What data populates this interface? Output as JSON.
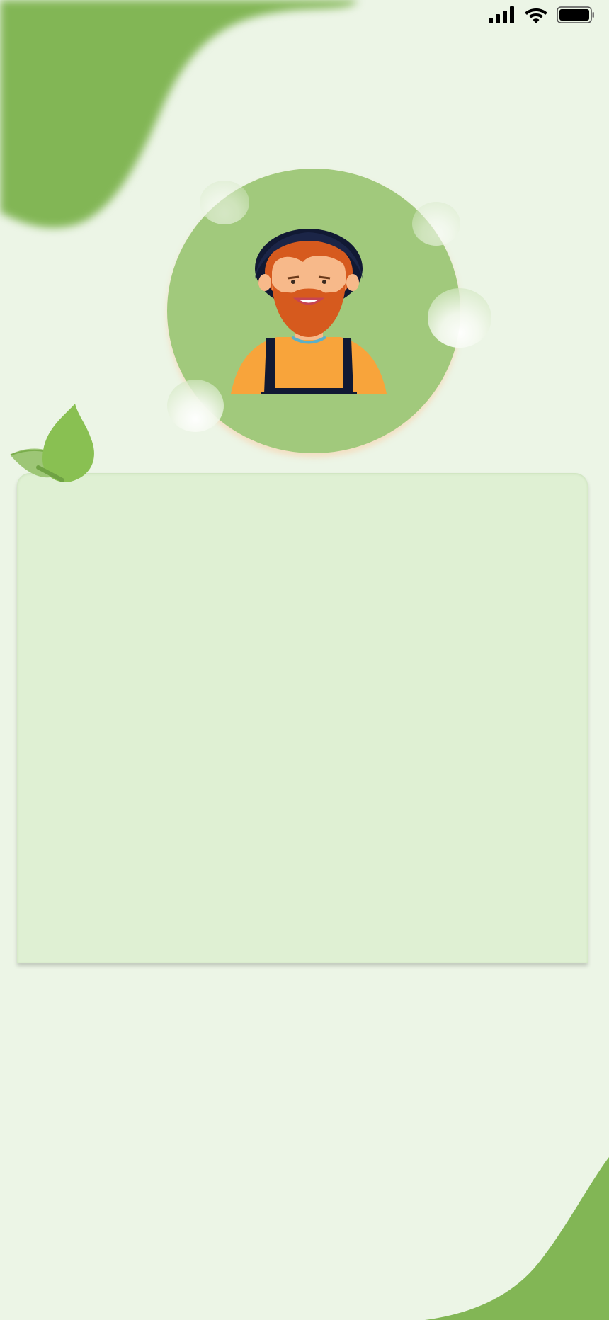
{
  "colors": {
    "background": "#ecf5e6",
    "accent_green": "#82b655",
    "avatar_circle": "#a1c97c",
    "card": "#dff0d3",
    "leaf_dark": "#89c052",
    "leaf_light": "#9dc676"
  },
  "status_bar": {
    "signal_icon": "cellular-signal-icon",
    "wifi_icon": "wifi-icon",
    "battery_icon": "battery-icon"
  },
  "avatar": {
    "icon": "farmer-avatar-illustration"
  },
  "decorations": {
    "leaf_icon": "leaf-icon"
  }
}
